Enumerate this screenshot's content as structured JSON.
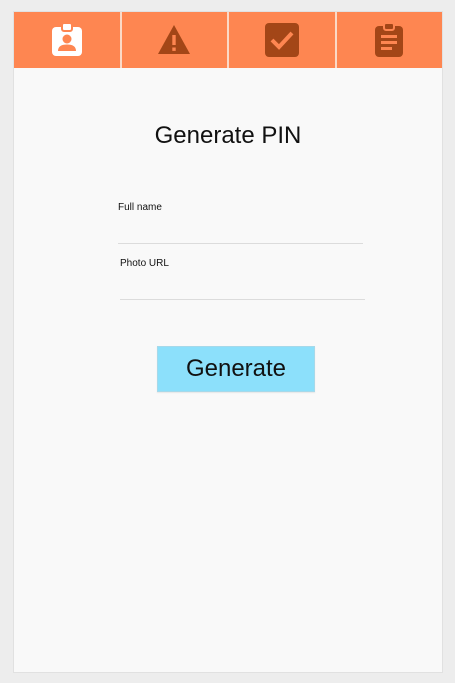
{
  "tabs": [
    {
      "icon": "id-badge-icon",
      "active": true
    },
    {
      "icon": "warning-icon",
      "active": false
    },
    {
      "icon": "checkbox-icon",
      "active": false
    },
    {
      "icon": "clipboard-icon",
      "active": false
    }
  ],
  "colors": {
    "tabbar": "#fe8651",
    "icon_active": "#ffffff",
    "icon_inactive": "#a34617",
    "button": "#8ce0fb",
    "background": "#f9f9f9"
  },
  "page": {
    "title": "Generate PIN"
  },
  "form": {
    "full_name_label": "Full name",
    "full_name_value": "",
    "photo_url_label": "Photo URL",
    "photo_url_value": "",
    "generate_label": "Generate"
  }
}
